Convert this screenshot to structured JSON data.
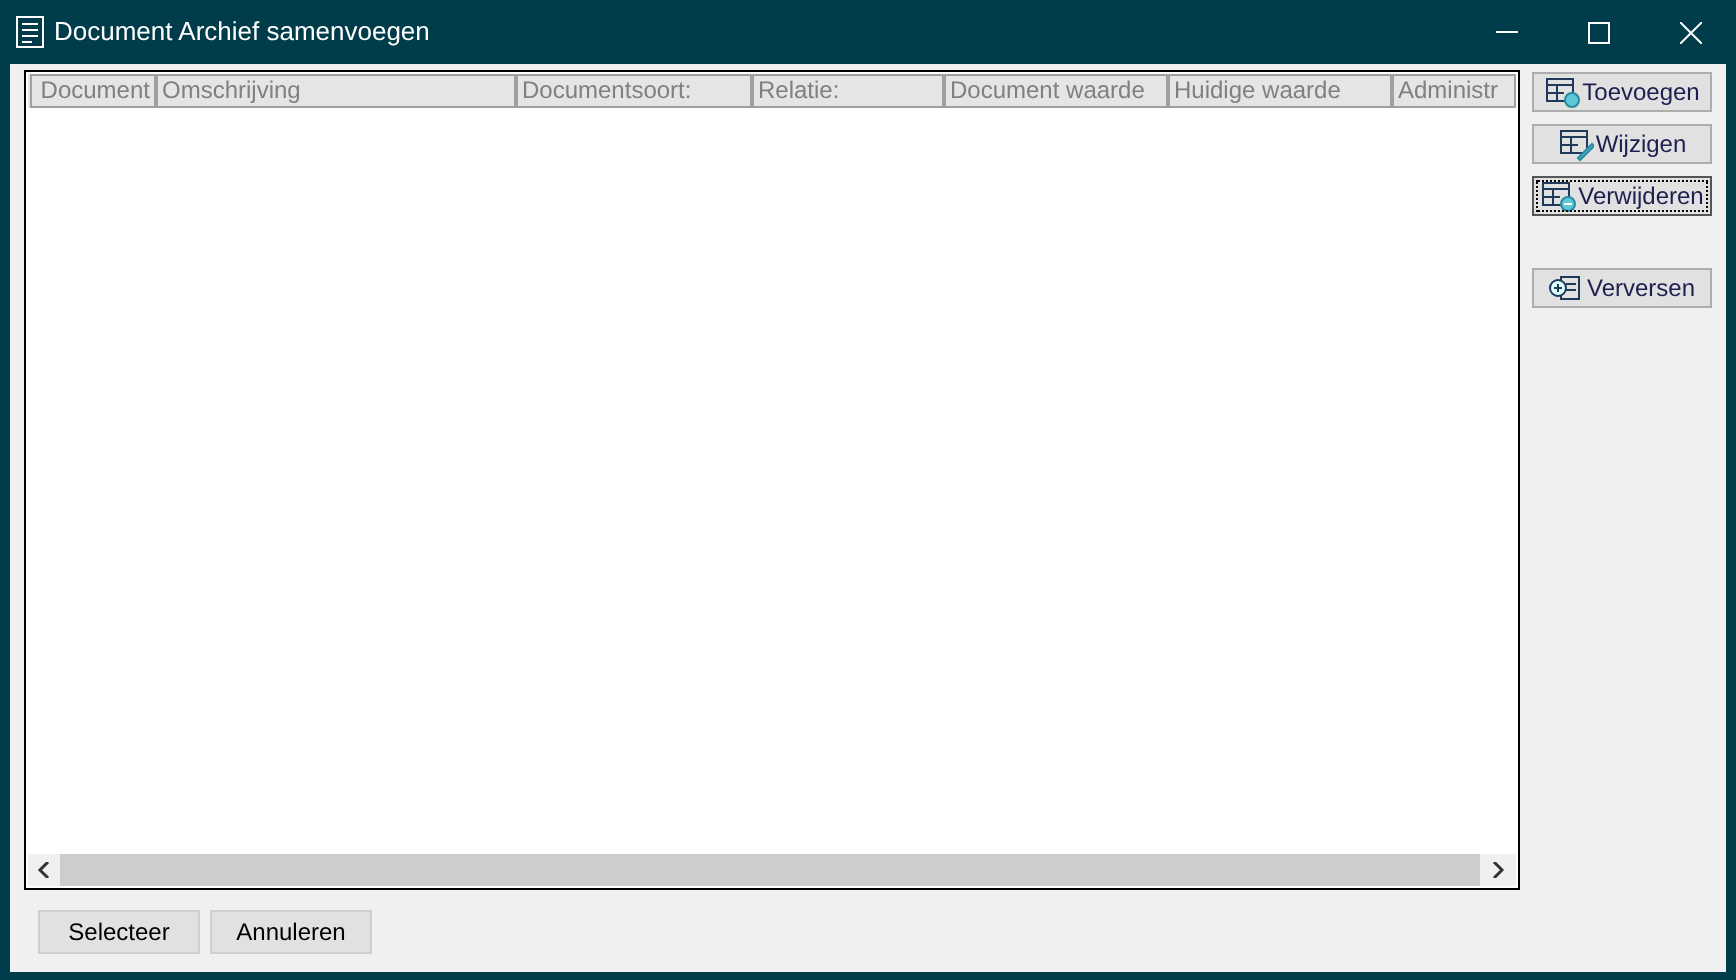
{
  "window": {
    "title": "Document Archief samenvoegen"
  },
  "table": {
    "columns": [
      "Document",
      "Omschrijving",
      "Documentsoort:",
      "Relatie:",
      "Document waarde",
      "Huidige waarde",
      "Administr"
    ]
  },
  "side_buttons": [
    {
      "label": "Toevoegen",
      "kind": "add",
      "focused": false
    },
    {
      "label": "Wijzigen",
      "kind": "edit",
      "focused": false
    },
    {
      "label": "Verwijderen",
      "kind": "remove",
      "focused": true
    },
    {
      "label": "Verversen",
      "kind": "refresh",
      "focused": false
    }
  ],
  "buttons": [
    "Selecteer",
    "Annuleren"
  ]
}
